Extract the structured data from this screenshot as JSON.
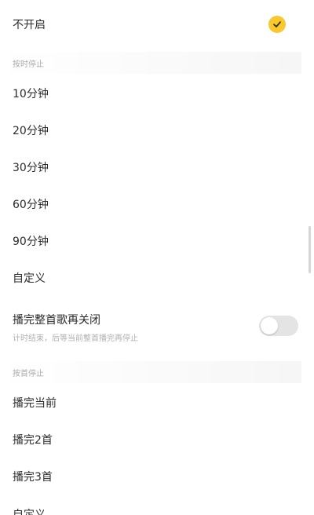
{
  "options": {
    "off": {
      "label": "不开启",
      "selected": true
    }
  },
  "timer_section": {
    "header": "按时停止",
    "items": [
      "10分钟",
      "20分钟",
      "30分钟",
      "60分钟",
      "90分钟",
      "自定义"
    ]
  },
  "finish_song": {
    "label": "播完整首歌再关闭",
    "description": "计时结束，后等当前整首播完再停止",
    "enabled": false
  },
  "song_section": {
    "header": "按首停止",
    "items": [
      "播完当前",
      "播完2首",
      "播完3首",
      "自定义"
    ]
  },
  "colors": {
    "accent": "#f7c832",
    "toggle_off": "#e4e4e4"
  },
  "icons": {
    "selected": "check-icon"
  }
}
